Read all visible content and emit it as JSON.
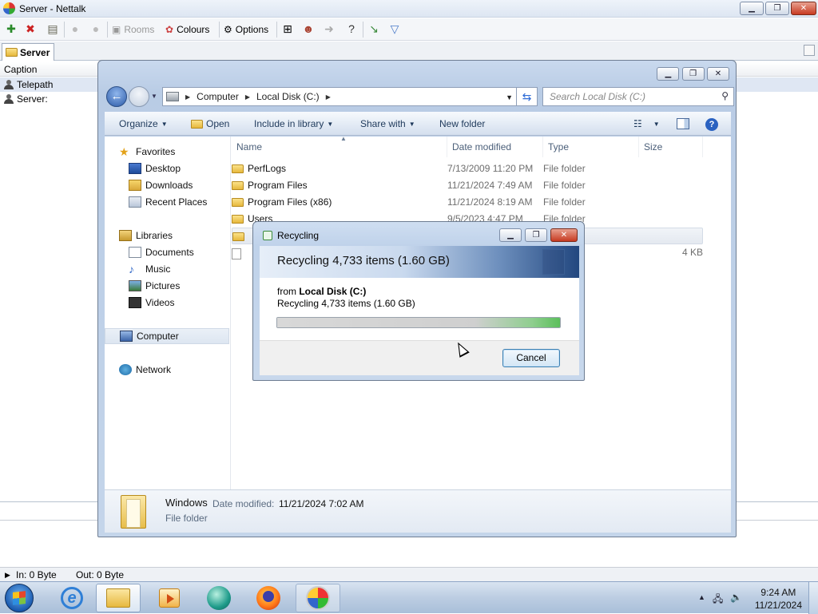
{
  "nettalk": {
    "title": "Server  -  Nettalk",
    "toolbar": {
      "rooms": "Rooms",
      "colours": "Colours",
      "options": "Options"
    },
    "tab": "Server",
    "list_header": "Caption",
    "rows": [
      "Telepath",
      "Server:"
    ],
    "status": {
      "in": "In:  0 Byte",
      "out": "Out:  0 Byte"
    }
  },
  "explorer": {
    "breadcrumb": [
      "Computer",
      "Local Disk (C:)"
    ],
    "search_placeholder": "Search Local Disk (C:)",
    "commands": {
      "organize": "Organize",
      "open": "Open",
      "include": "Include in library",
      "share": "Share with",
      "new_folder": "New folder"
    },
    "nav": {
      "favorites": "Favorites",
      "desktop": "Desktop",
      "downloads": "Downloads",
      "recent": "Recent Places",
      "libraries": "Libraries",
      "documents": "Documents",
      "music": "Music",
      "pictures": "Pictures",
      "videos": "Videos",
      "computer": "Computer",
      "network": "Network"
    },
    "columns": {
      "name": "Name",
      "date": "Date modified",
      "type": "Type",
      "size": "Size"
    },
    "files": [
      {
        "name": "PerfLogs",
        "date": "7/13/2009 11:20 PM",
        "type": "File folder",
        "size": ""
      },
      {
        "name": "Program Files",
        "date": "11/21/2024 7:49 AM",
        "type": "File folder",
        "size": ""
      },
      {
        "name": "Program Files (x86)",
        "date": "11/21/2024 8:19 AM",
        "type": "File folder",
        "size": ""
      },
      {
        "name": "Users",
        "date": "9/5/2023 4:47 PM",
        "type": "File folder",
        "size": ""
      },
      {
        "name": "",
        "date": "",
        "type": "",
        "size": ""
      },
      {
        "name": "",
        "date": "",
        "type": "",
        "size": "4 KB"
      }
    ],
    "details": {
      "name": "Windows",
      "date_label": "Date modified:",
      "date": "11/21/2024 7:02 AM",
      "type": "File folder"
    }
  },
  "dialog": {
    "title": "Recycling",
    "heading": "Recycling 4,733 items (1.60 GB)",
    "from_label": "from",
    "from_value": "Local Disk (C:)",
    "status": "Recycling 4,733 items (1.60 GB)",
    "cancel": "Cancel",
    "progress_percent": 100
  },
  "taskbar": {
    "time": "9:24 AM",
    "date": "11/21/2024"
  },
  "icons": {
    "toolbar": [
      "add-user-icon",
      "delete-icon",
      "properties-icon",
      "user-icon",
      "user-icon",
      "rooms-icon",
      "colours-icon",
      "options-icon",
      "network-icon",
      "users-icon",
      "send-icon",
      "help-icon",
      "connect-icon",
      "dropdown-icon"
    ],
    "tray": [
      "arrow-up-icon",
      "network-icon",
      "volume-icon"
    ]
  },
  "colors": {
    "accent": "#2c5aa8",
    "progress": "#5bbf5b",
    "close": "#c73a21"
  }
}
